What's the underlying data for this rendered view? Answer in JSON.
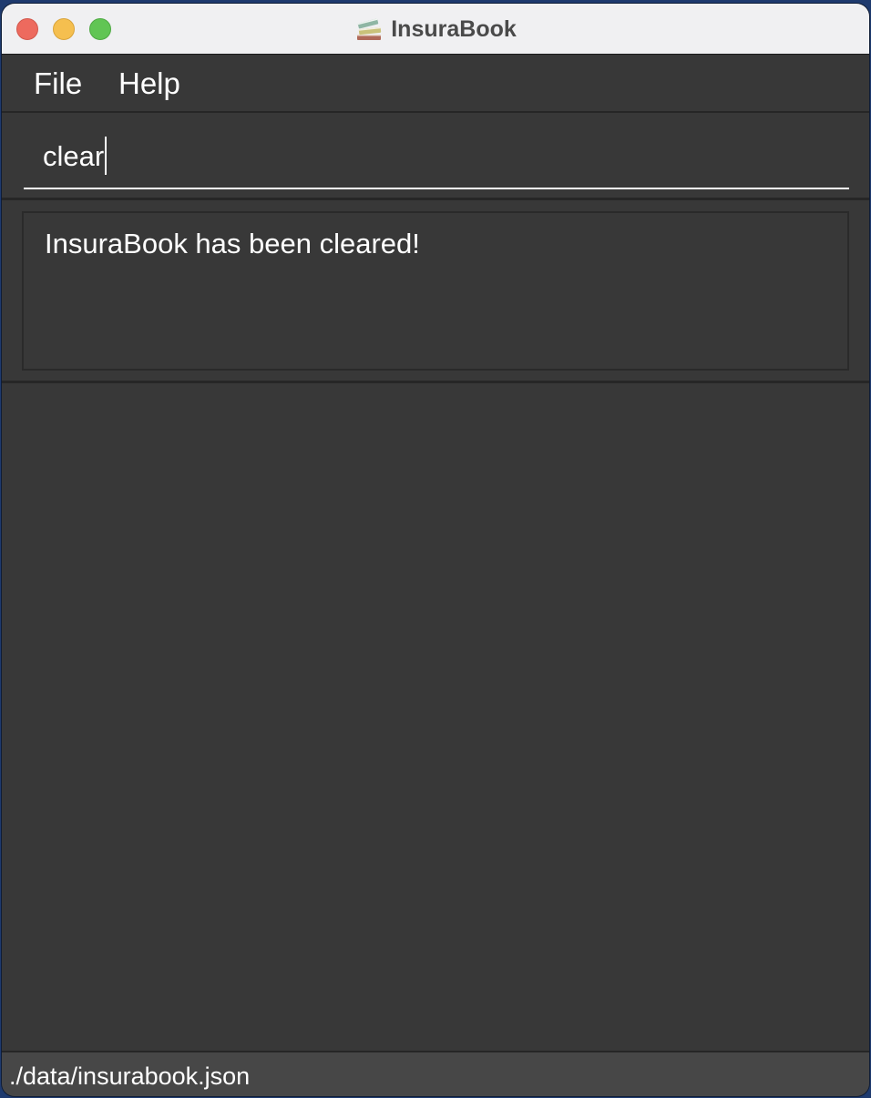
{
  "window": {
    "title": "InsuraBook",
    "app_icon": "stacked-books-icon"
  },
  "menubar": {
    "items": [
      {
        "label": "File"
      },
      {
        "label": "Help"
      }
    ]
  },
  "command_box": {
    "value": "clear",
    "placeholder": ""
  },
  "result_display": {
    "message": "InsuraBook has been cleared!"
  },
  "person_list": {
    "items": []
  },
  "status_bar": {
    "save_location": "./data/insurabook.json"
  },
  "colors": {
    "background": "#383838",
    "status_bar": "#474747",
    "text": "#ffffff",
    "titlebar": "#f0f0f2",
    "close_button": "#ed6a5e",
    "minimize_button": "#f5bf4f",
    "maximize_button": "#61c554"
  }
}
